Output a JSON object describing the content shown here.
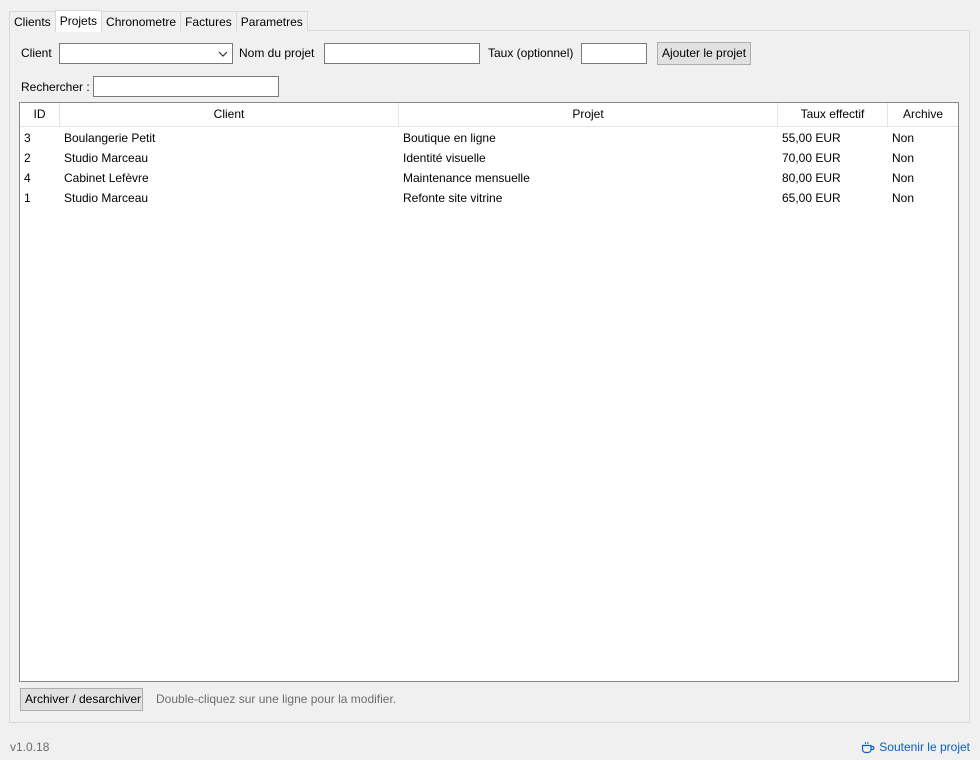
{
  "tabs": [
    "Clients",
    "Projets",
    "Chronometre",
    "Factures",
    "Parametres"
  ],
  "form": {
    "client_label": "Client",
    "client_value": "",
    "project_name_label": "Nom du projet",
    "project_name_value": "",
    "rate_label": "Taux (optionnel)",
    "rate_value": "",
    "add_button": "Ajouter le projet",
    "search_label": "Rechercher :",
    "search_value": ""
  },
  "table": {
    "columns": [
      "ID",
      "Client",
      "Projet",
      "Taux effectif",
      "Archive"
    ],
    "rows": [
      {
        "id": "3",
        "client": "Boulangerie Petit",
        "project": "Boutique en ligne",
        "rate": "55,00 EUR",
        "archived": "Non"
      },
      {
        "id": "2",
        "client": "Studio Marceau",
        "project": "Identité visuelle",
        "rate": "70,00 EUR",
        "archived": "Non"
      },
      {
        "id": "4",
        "client": "Cabinet Lefèvre",
        "project": "Maintenance mensuelle",
        "rate": "80,00 EUR",
        "archived": "Non"
      },
      {
        "id": "1",
        "client": "Studio Marceau",
        "project": "Refonte site vitrine",
        "rate": "65,00 EUR",
        "archived": "Non"
      }
    ]
  },
  "footer": {
    "archive_button": "Archiver / desarchiver",
    "hint": "Double-cliquez sur une ligne pour la modifier.",
    "version": "v1.0.18",
    "support_link": "Soutenir le projet",
    "support_icon": "coffee-cup-icon"
  },
  "colors": {
    "link": "#0a5fc7",
    "table_border": "#828790",
    "button_bg": "#e1e1e1"
  }
}
